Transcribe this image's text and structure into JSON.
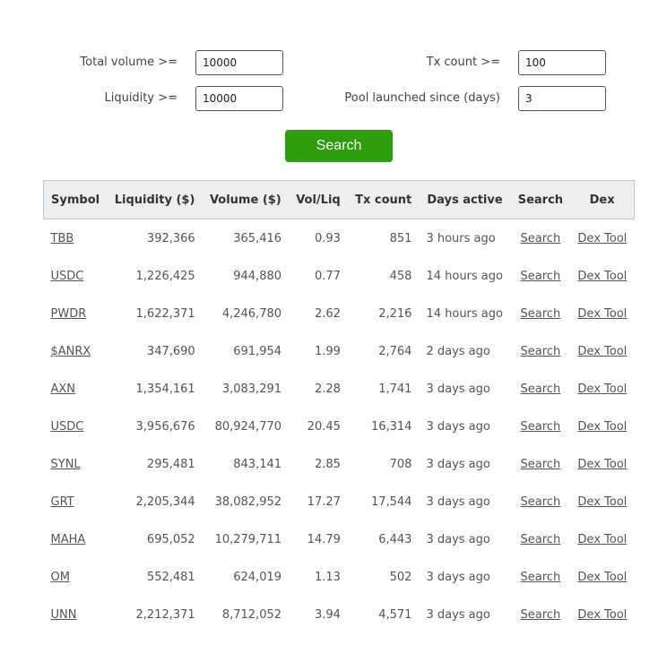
{
  "filters": {
    "total_volume": {
      "label": "Total volume >=",
      "value": "10000"
    },
    "liquidity": {
      "label": "Liquidity >=",
      "value": "10000"
    },
    "tx_count": {
      "label": "Tx count >=",
      "value": "100"
    },
    "pool_launched": {
      "label": "Pool launched since (days)",
      "value": "3"
    },
    "search_label": "Search"
  },
  "table": {
    "headers": [
      "Symbol",
      "Liquidity ($)",
      "Volume ($)",
      "Vol/Liq",
      "Tx count",
      "Days active",
      "Search",
      "Dex"
    ],
    "rows": [
      {
        "symbol": "TBB",
        "liquidity": "392,366",
        "volume": "365,416",
        "vol_liq": "0.93",
        "tx": "851",
        "days": "3 hours ago",
        "search": "Search",
        "dex": "Dex Tool"
      },
      {
        "symbol": "USDC",
        "liquidity": "1,226,425",
        "volume": "944,880",
        "vol_liq": "0.77",
        "tx": "458",
        "days": "14 hours ago",
        "search": "Search",
        "dex": "Dex Tool"
      },
      {
        "symbol": "PWDR",
        "liquidity": "1,622,371",
        "volume": "4,246,780",
        "vol_liq": "2.62",
        "tx": "2,216",
        "days": "14 hours ago",
        "search": "Search",
        "dex": "Dex Tool"
      },
      {
        "symbol": "$ANRX",
        "liquidity": "347,690",
        "volume": "691,954",
        "vol_liq": "1.99",
        "tx": "2,764",
        "days": "2 days ago",
        "search": "Search",
        "dex": "Dex Tool"
      },
      {
        "symbol": "AXN",
        "liquidity": "1,354,161",
        "volume": "3,083,291",
        "vol_liq": "2.28",
        "tx": "1,741",
        "days": "3 days ago",
        "search": "Search",
        "dex": "Dex Tool"
      },
      {
        "symbol": "USDC",
        "liquidity": "3,956,676",
        "volume": "80,924,770",
        "vol_liq": "20.45",
        "tx": "16,314",
        "days": "3 days ago",
        "search": "Search",
        "dex": "Dex Tool"
      },
      {
        "symbol": "SYNL",
        "liquidity": "295,481",
        "volume": "843,141",
        "vol_liq": "2.85",
        "tx": "708",
        "days": "3 days ago",
        "search": "Search",
        "dex": "Dex Tool"
      },
      {
        "symbol": "GRT",
        "liquidity": "2,205,344",
        "volume": "38,082,952",
        "vol_liq": "17.27",
        "tx": "17,544",
        "days": "3 days ago",
        "search": "Search",
        "dex": "Dex Tool"
      },
      {
        "symbol": "MAHA",
        "liquidity": "695,052",
        "volume": "10,279,711",
        "vol_liq": "14.79",
        "tx": "6,443",
        "days": "3 days ago",
        "search": "Search",
        "dex": "Dex Tool"
      },
      {
        "symbol": "OM",
        "liquidity": "552,481",
        "volume": "624,019",
        "vol_liq": "1.13",
        "tx": "502",
        "days": "3 days ago",
        "search": "Search",
        "dex": "Dex Tool"
      },
      {
        "symbol": "UNN",
        "liquidity": "2,212,371",
        "volume": "8,712,052",
        "vol_liq": "3.94",
        "tx": "4,571",
        "days": "3 days ago",
        "search": "Search",
        "dex": "Dex Tool"
      }
    ]
  },
  "colors": {
    "accent": "#2f9e0c",
    "header_bg": "#eeeeee",
    "header_border": "#b9c9db"
  }
}
